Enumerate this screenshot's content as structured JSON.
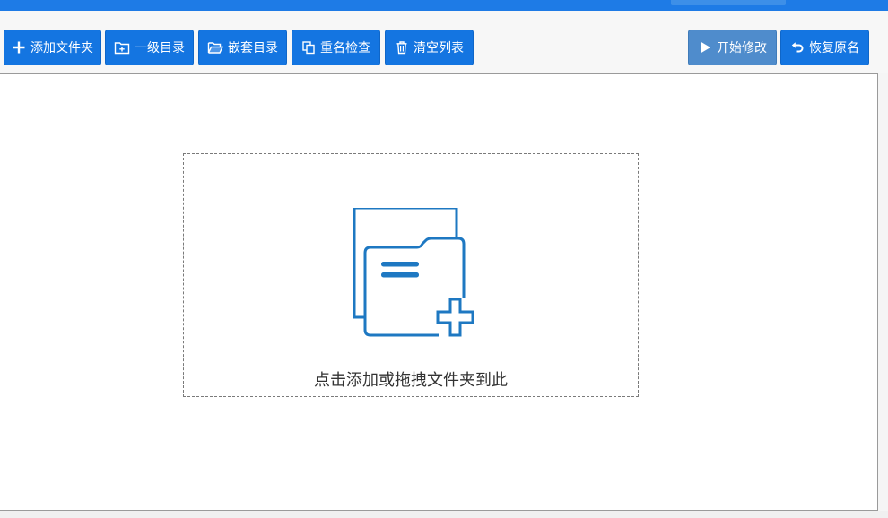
{
  "toolbar": {
    "add_folder_label": "添加文件夹",
    "level1_dir_label": "一级目录",
    "nested_dir_label": "嵌套目录",
    "duplicate_check_label": "重名检查",
    "clear_list_label": "清空列表",
    "start_modify_label": "开始修改",
    "restore_names_label": "恢复原名"
  },
  "dropzone": {
    "hint": "点击添加或拖拽文件夹到此"
  },
  "colors": {
    "accent": "#1475e1",
    "accent_light": "#4f8ccc",
    "illustration": "#1e78c2"
  },
  "icons": {
    "add_folder": "plus-icon",
    "level1_dir": "folder-add-icon",
    "nested_dir": "folder-open-icon",
    "duplicate_check": "copy-icon",
    "clear_list": "trash-icon",
    "start_modify": "play-icon",
    "restore_names": "undo-icon",
    "dropzone": "folder-plus-illustration-icon"
  }
}
